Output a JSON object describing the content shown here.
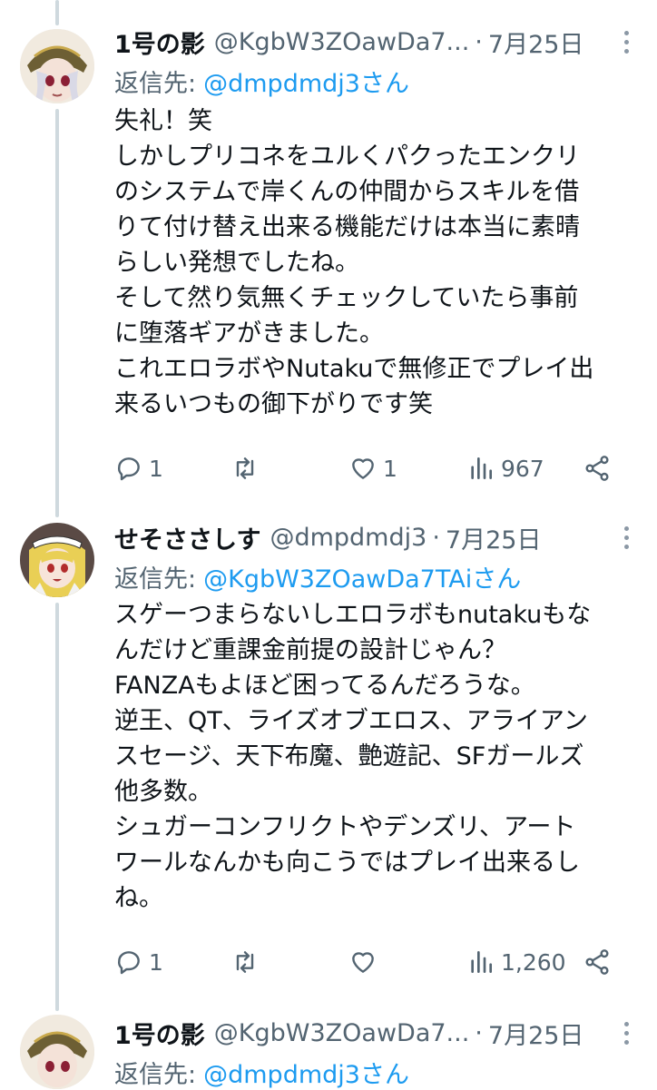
{
  "tweets": [
    {
      "name": "1号の影",
      "handle": "@KgbW3ZOawDa7...",
      "separator": "·",
      "date": "7月25日",
      "reply_prefix": "返信先:",
      "reply_mention": "@dmpdmdj3さん",
      "lines": [
        "失礼！笑",
        "しかしプリコネをユルくパクったエンクリ",
        "のシステムで岸くんの仲間からスキルを借",
        "りて付け替え出来る機能だけは本当に素晴",
        "らしい発想でしたね。",
        "そして然り気無くチェックしていたら事前",
        "に堕落ギアがきました。",
        "これエロラボやNutakuで無修正でプレイ出",
        "来るいつもの御下がりです笑"
      ],
      "actions": {
        "replies": "1",
        "retweets": "",
        "likes": "1",
        "views": "967"
      },
      "icons": {
        "reply": "reply-icon",
        "retweet": "retweet-icon",
        "like": "heart-icon",
        "views": "views-icon",
        "share": "share-icon",
        "more": "more-icon"
      }
    },
    {
      "name": "せそささしす",
      "handle": "@dmpdmdj3",
      "separator": "·",
      "date": "7月25日",
      "reply_prefix": "返信先:",
      "reply_mention": "@KgbW3ZOawDa7TAiさん",
      "lines": [
        "スゲーつまらないしエロラボもnutakuもな",
        "んだけど重課金前提の設計じゃん？",
        "FANZAもよほど困ってるんだろうな。",
        "逆王、QT、ライズオブエロス、アライアン",
        "スセージ、天下布魔、艶遊記、SFガールズ",
        "他多数。",
        "シュガーコンフリクトやデンズリ、アート",
        "ワールなんかも向こうではプレイ出来るし",
        "ね。"
      ],
      "actions": {
        "replies": "1",
        "retweets": "",
        "likes": "",
        "views": "1,260"
      },
      "icons": {
        "reply": "reply-icon",
        "retweet": "retweet-icon",
        "like": "heart-icon",
        "views": "views-icon",
        "share": "share-icon",
        "more": "more-icon"
      }
    },
    {
      "name": "1号の影",
      "handle": "@KgbW3ZOawDa7...",
      "separator": "·",
      "date": "7月25日",
      "reply_prefix": "返信先:",
      "reply_mention": "@dmpdmdj3さん",
      "lines": [],
      "actions": {},
      "icons": {
        "more": "more-icon"
      }
    }
  ],
  "colors": {
    "text": "#0f1419",
    "secondary": "#536471",
    "link": "#1d9bf0",
    "thread_line": "#cfd9de"
  }
}
